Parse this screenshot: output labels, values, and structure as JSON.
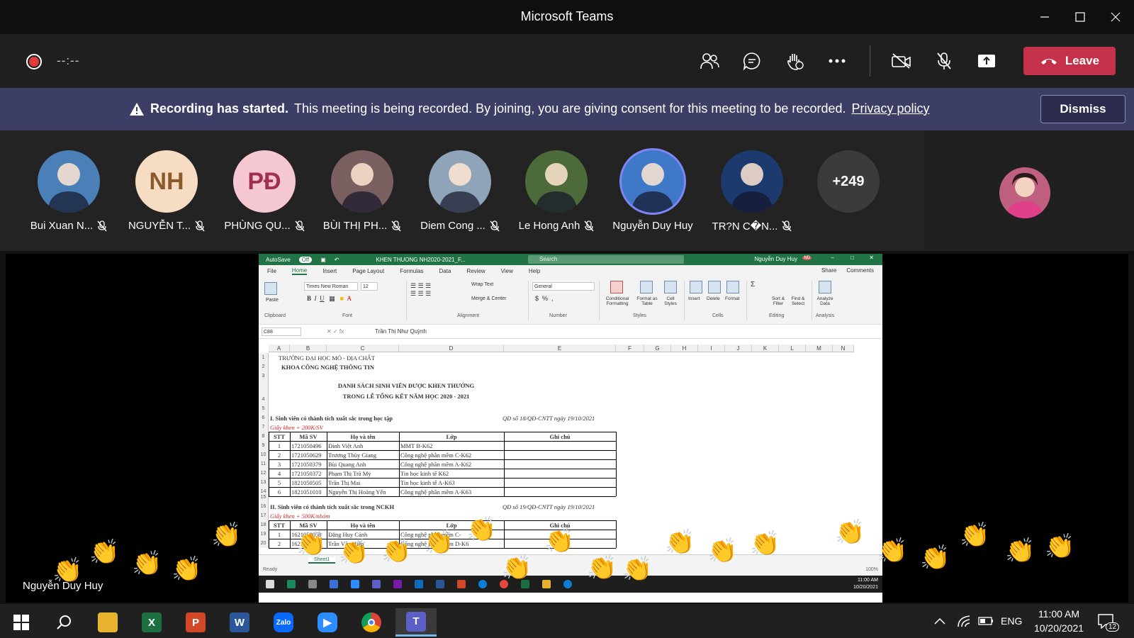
{
  "window": {
    "title": "Microsoft Teams"
  },
  "toolbar": {
    "timer": "--:--",
    "leave_label": "Leave"
  },
  "banner": {
    "headline": "Recording has started.",
    "message": "This meeting is being recorded. By joining, you are giving consent for this meeting to be recorded.",
    "link": "Privacy policy",
    "dismiss_label": "Dismiss"
  },
  "participants": [
    {
      "name": "Bui Xuan N...",
      "initials": "",
      "color": "#4a7fb8"
    },
    {
      "name": "NGUYỄN T...",
      "initials": "NH",
      "color": "#f7dcc4",
      "text_color": "#8a5a2b"
    },
    {
      "name": "PHÙNG QU...",
      "initials": "PĐ",
      "color": "#f4c7d1",
      "text_color": "#a0304f"
    },
    {
      "name": "BÙI THỊ PH...",
      "initials": "",
      "color": "#7a6060"
    },
    {
      "name": "Diem Cong ...",
      "initials": "",
      "color": "#8fa4b8"
    },
    {
      "name": "Le Hong Anh",
      "initials": "",
      "color": "#4c6a3a"
    },
    {
      "name": "Nguyễn Duy Huy",
      "initials": "",
      "color": "#3e78c7"
    },
    {
      "name": "TR?N C�N...",
      "initials": "",
      "color": "#1c3a6e"
    }
  ],
  "more_count": "+249",
  "presenter_name": "Nguyễn Duy Huy",
  "excel": {
    "autosave": "AutoSave",
    "autosave_state": "Off",
    "filename": "KHEN THUONG NH2020-2021_F...",
    "search": "Search",
    "user": "Nguyễn Duy Huy",
    "user_initials": "ND",
    "tabs": [
      "File",
      "Home",
      "Insert",
      "Page Layout",
      "Formulas",
      "Data",
      "Review",
      "View",
      "Help"
    ],
    "share": "Share",
    "comments": "Comments",
    "font_name": "Times New Roman",
    "font_size": "12",
    "number_format": "General",
    "wrap_text": "Wrap Text",
    "merge_center": "Merge & Center",
    "ribbon_groups": [
      "Clipboard",
      "Font",
      "Alignment",
      "Number",
      "Styles",
      "Cells",
      "Editing",
      "Analysis"
    ],
    "ribbon_buttons": {
      "paste": "Paste",
      "conditional": "Conditional Formatting",
      "format_table": "Format as Table",
      "cell_styles": "Cell Styles",
      "insert": "Insert",
      "delete": "Delete",
      "format": "Format",
      "sort_filter": "Sort & Filter",
      "find_select": "Find & Select",
      "analyze": "Analyze Data"
    },
    "name_box": "C88",
    "formula": "Trần Thị Như Quỳnh",
    "columns": [
      "A",
      "B",
      "C",
      "D",
      "E",
      "F",
      "G",
      "H",
      "I",
      "J",
      "K",
      "L",
      "M",
      "N"
    ],
    "rows": [
      "1",
      "2",
      "3",
      "4",
      "5",
      "6",
      "7",
      "8",
      "9",
      "10",
      "11",
      "12",
      "13",
      "14",
      "15",
      "16",
      "17",
      "18",
      "19",
      "20"
    ],
    "header1": "TRƯỜNG ĐẠI HỌC MỎ - ĐỊA CHẤT",
    "header2": "KHOA CÔNG NGHỆ THÔNG TIN",
    "doc_title1": "DANH SÁCH SINH VIÊN ĐƯỢC KHEN THƯỞNG",
    "doc_title2": "TRONG LỄ TỔNG KẾT NĂM HỌC 2020 - 2021",
    "section1": "I. Sinh viên có thành tích xuất sắc trong học tập",
    "decision1": "QĐ số 18/QĐ-CNTT ngày 19/10/2021",
    "reward1": "Giấy khen + 200K/SV",
    "section2": "II. Sinh viên có thành tích xuất sắc trong NCKH",
    "decision2": "QĐ số 19/QĐ-CNTT ngày 19/10/2021",
    "reward2": "Giấy khen + 500K/nhóm",
    "table_headers": [
      "STT",
      "Mã SV",
      "Họ và tên",
      "Lớp",
      "Ghi chú"
    ],
    "table1": [
      [
        "1",
        "1721050496",
        "Đinh Việt Anh",
        "MMT B-K62"
      ],
      [
        "2",
        "1721050629",
        "Trương Thùy Giang",
        "Công nghệ phần mềm C-K62"
      ],
      [
        "3",
        "1721050379",
        "Bùi Quang Anh",
        "Công nghệ phần mềm A-K62"
      ],
      [
        "4",
        "1721050372",
        "Phạm Thị Trà My",
        "Tin học kinh tế K62"
      ],
      [
        "5",
        "1821050505",
        "Trần Thị Mai",
        "Tin học kinh tế A-K63"
      ],
      [
        "6",
        "1821051010",
        "Nguyễn Thị Hoàng Yến",
        "Công nghệ phần mềm A-K63"
      ]
    ],
    "table2": [
      [
        "1",
        "1621050058",
        "Đặng Huy Cảnh",
        "Công nghệ phần mềm C-"
      ],
      [
        "2",
        "16210513",
        "Trần Văn Hiệp",
        "Công nghệ phần mềm D-K6"
      ]
    ],
    "sheet_tab": "Sheet1",
    "status": "Ready",
    "zoom": "100%",
    "clock_time": "11:00 AM",
    "clock_date": "10/20/2021"
  },
  "taskbar": {
    "apps": [
      "file-explorer",
      "excel",
      "powerpoint",
      "word",
      "zalo",
      "zoom",
      "chrome",
      "teams"
    ],
    "language": "ENG",
    "time": "11:00 AM",
    "date": "10/20/2021",
    "notification_count": "12"
  }
}
